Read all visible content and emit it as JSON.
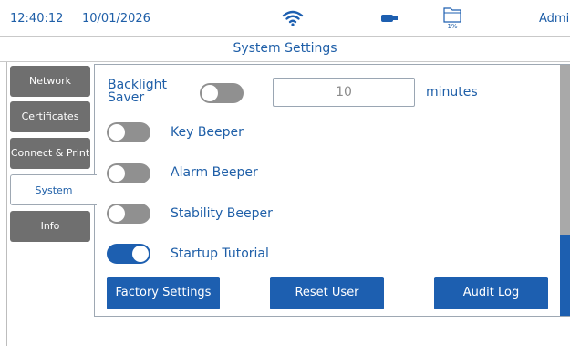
{
  "status": {
    "time": "12:40:12",
    "date": "10/01/2026",
    "storage_percent": "1%",
    "user": "Admin"
  },
  "title": "System Settings",
  "tabs": [
    {
      "label": "Network",
      "active": false
    },
    {
      "label": "Certificates",
      "active": false
    },
    {
      "label": "Connect & Print",
      "active": false
    },
    {
      "label": "System",
      "active": true
    },
    {
      "label": "Info",
      "active": false
    }
  ],
  "settings": {
    "backlight_saver": {
      "label_line1": "Backlight",
      "label_line2": "Saver",
      "enabled": false,
      "value": "10",
      "unit": "minutes"
    },
    "key_beeper": {
      "label": "Key Beeper",
      "enabled": false
    },
    "alarm_beeper": {
      "label": "Alarm Beeper",
      "enabled": false
    },
    "stability_beeper": {
      "label": "Stability Beeper",
      "enabled": false
    },
    "startup_tutorial": {
      "label": "Startup Tutorial",
      "enabled": true
    }
  },
  "buttons": {
    "factory_settings": "Factory Settings",
    "reset_user": "Reset User",
    "audit_log": "Audit Log"
  },
  "icons": {
    "wifi": "wifi-icon",
    "usb": "usb-icon",
    "storage": "storage-icon"
  },
  "colors": {
    "accent": "#1d5fb0",
    "text": "#1f5fa8",
    "tab_inactive": "#6f6f6f",
    "toggle_off": "#909090"
  }
}
